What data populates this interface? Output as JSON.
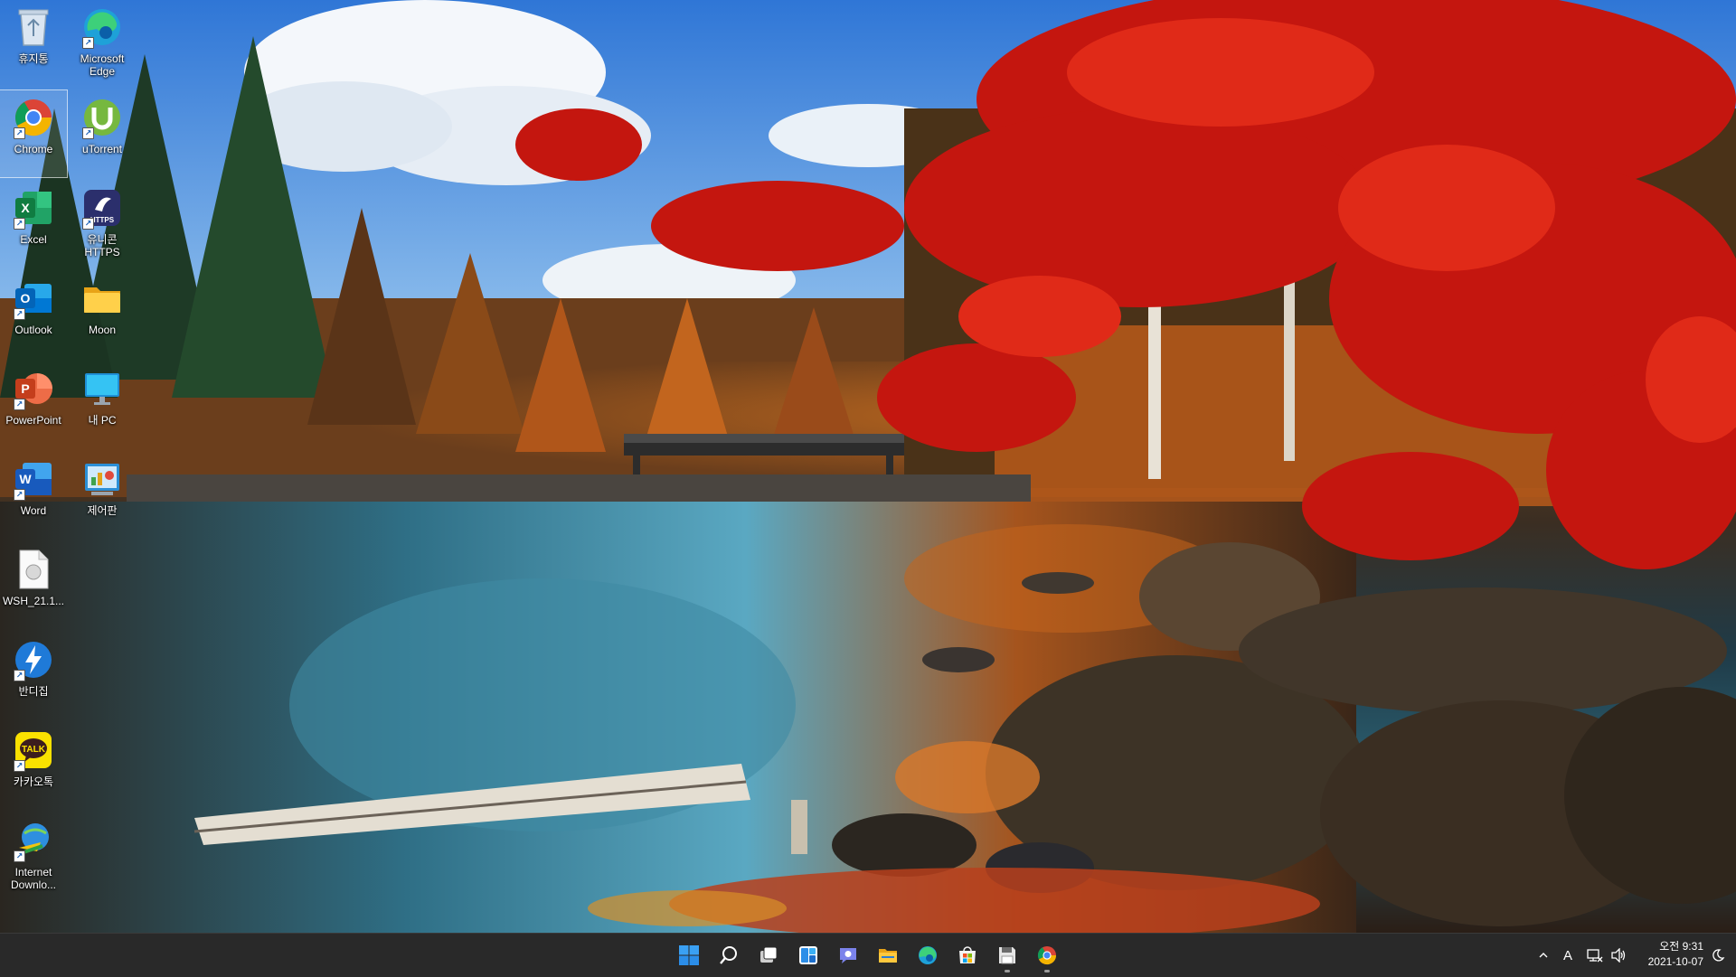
{
  "desktop": {
    "icons": [
      {
        "id": "recycle-bin",
        "label": "휴지통",
        "icon": "recycle-bin-icon",
        "shortcut": false
      },
      {
        "id": "microsoft-edge",
        "label": "Microsoft Edge",
        "icon": "edge-icon",
        "shortcut": true
      },
      {
        "id": "chrome",
        "label": "Chrome",
        "icon": "chrome-icon",
        "shortcut": true,
        "selected": true
      },
      {
        "id": "utorrent",
        "label": "uTorrent",
        "icon": "utorrent-icon",
        "shortcut": true
      },
      {
        "id": "excel",
        "label": "Excel",
        "icon": "excel-icon",
        "shortcut": true
      },
      {
        "id": "unicorn-https",
        "label": "유니콘 HTTPS",
        "icon": "unicorn-https-icon",
        "shortcut": true
      },
      {
        "id": "outlook",
        "label": "Outlook",
        "icon": "outlook-icon",
        "shortcut": true
      },
      {
        "id": "moon",
        "label": "Moon",
        "icon": "folder-icon",
        "shortcut": false
      },
      {
        "id": "powerpoint",
        "label": "PowerPoint",
        "icon": "powerpoint-icon",
        "shortcut": true
      },
      {
        "id": "this-pc",
        "label": "내 PC",
        "icon": "monitor-icon",
        "shortcut": false
      },
      {
        "id": "word",
        "label": "Word",
        "icon": "word-icon",
        "shortcut": true
      },
      {
        "id": "control-panel",
        "label": "제어판",
        "icon": "control-panel-icon",
        "shortcut": false
      },
      {
        "id": "wsh",
        "label": "WSH_21.1...",
        "icon": "document-icon",
        "shortcut": false
      },
      {
        "id": "bandizip",
        "label": "반디집",
        "icon": "bandizip-icon",
        "shortcut": true
      },
      {
        "id": "kakaotalk",
        "label": "카카오톡",
        "icon": "kakaotalk-icon",
        "shortcut": true
      },
      {
        "id": "internet-download",
        "label": "Internet Downlo...",
        "icon": "idm-icon",
        "shortcut": true
      }
    ],
    "badge_texts": {
      "https": "HTTPS",
      "talk": "TALK",
      "x": "X",
      "o": "O",
      "p": "P",
      "w": "W"
    }
  },
  "taskbar": {
    "apps": [
      {
        "id": "start",
        "icon": "windows-start-icon",
        "running": false
      },
      {
        "id": "search",
        "icon": "search-icon",
        "running": false
      },
      {
        "id": "task-view",
        "icon": "task-view-icon",
        "running": false
      },
      {
        "id": "widgets",
        "icon": "widgets-icon",
        "running": false
      },
      {
        "id": "chat",
        "icon": "teams-chat-icon",
        "running": false
      },
      {
        "id": "file-explorer",
        "icon": "file-explorer-icon",
        "running": false
      },
      {
        "id": "edge",
        "icon": "edge-icon",
        "running": false
      },
      {
        "id": "store",
        "icon": "store-icon",
        "running": false
      },
      {
        "id": "save-app",
        "icon": "floppy-icon",
        "running": true
      },
      {
        "id": "chrome",
        "icon": "chrome-icon",
        "running": true
      }
    ],
    "tray": {
      "chevron": "^",
      "ime": "A",
      "time": "오전 9:31",
      "date": "2021-10-07"
    }
  },
  "colors": {
    "taskbar_bg": "#202020",
    "accent_blue": "#0a84ff"
  }
}
